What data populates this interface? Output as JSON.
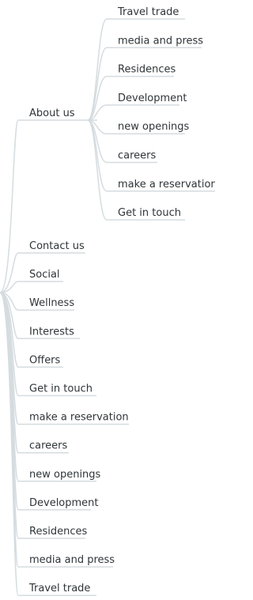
{
  "about_node": {
    "label": "About us",
    "children": [
      "Travel trade",
      "media and press",
      "Residences",
      "Development",
      "new openings",
      "careers",
      "make a reservation",
      "Get in touch"
    ]
  },
  "root_children": [
    "Contact us",
    "Social",
    "Wellness",
    "Interests",
    "Offers",
    "Get in touch",
    "make a reservation",
    "careers",
    "new openings",
    "Development",
    "Residences",
    "media and press",
    "Travel trade"
  ],
  "colors": {
    "line": "#d5dcdf",
    "text": "#2f3538"
  }
}
